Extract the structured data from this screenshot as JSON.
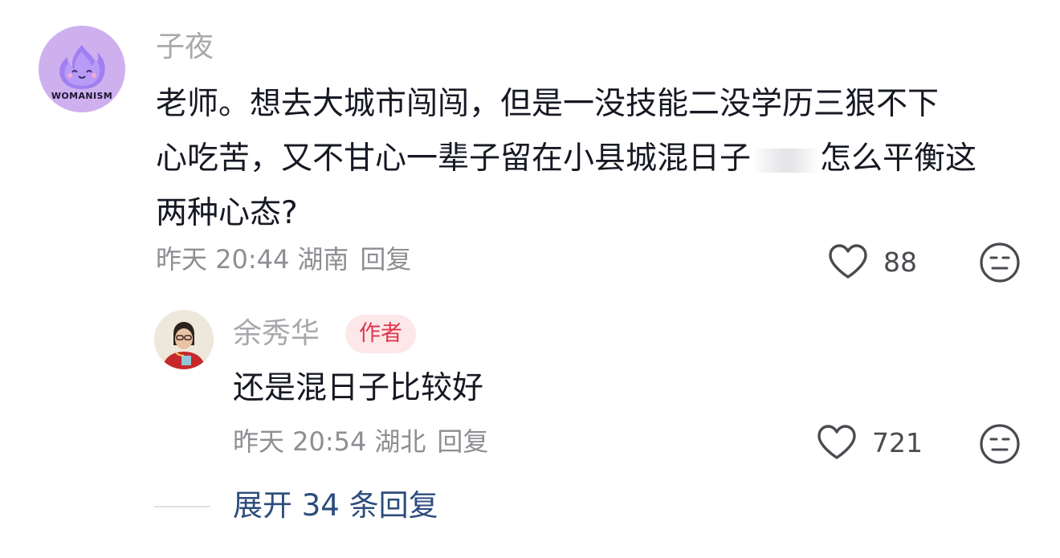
{
  "comment": {
    "avatar_brand": "WOMANISM",
    "username": "子夜",
    "text_lines": [
      "老师。想去大城市闯闯，但是一没技能二没学历三狠不下",
      "心吃苦，又不甘心一辈子留在小县城混日子",
      "怎么平衡这",
      "两种心态?"
    ],
    "time": "昨天 20:44",
    "location": "湖南",
    "reply_label": "回复",
    "like_count": "88"
  },
  "reply": {
    "username": "余秀华",
    "badge": "作者",
    "text": "还是混日子比较好",
    "time": "昨天 20:54",
    "location": "湖北",
    "reply_label": "回复",
    "like_count": "721"
  },
  "expand": {
    "label": "展开 34 条回复"
  },
  "icons": {
    "like": "heart-outline-icon",
    "dislike": "neutral-face-icon"
  },
  "colors": {
    "username": "#a9a9ad",
    "text": "#161823",
    "meta": "#8e8e93",
    "badge_bg": "#fde7e9",
    "badge_text": "#e0364b",
    "expand_link": "#2d4c7c"
  }
}
